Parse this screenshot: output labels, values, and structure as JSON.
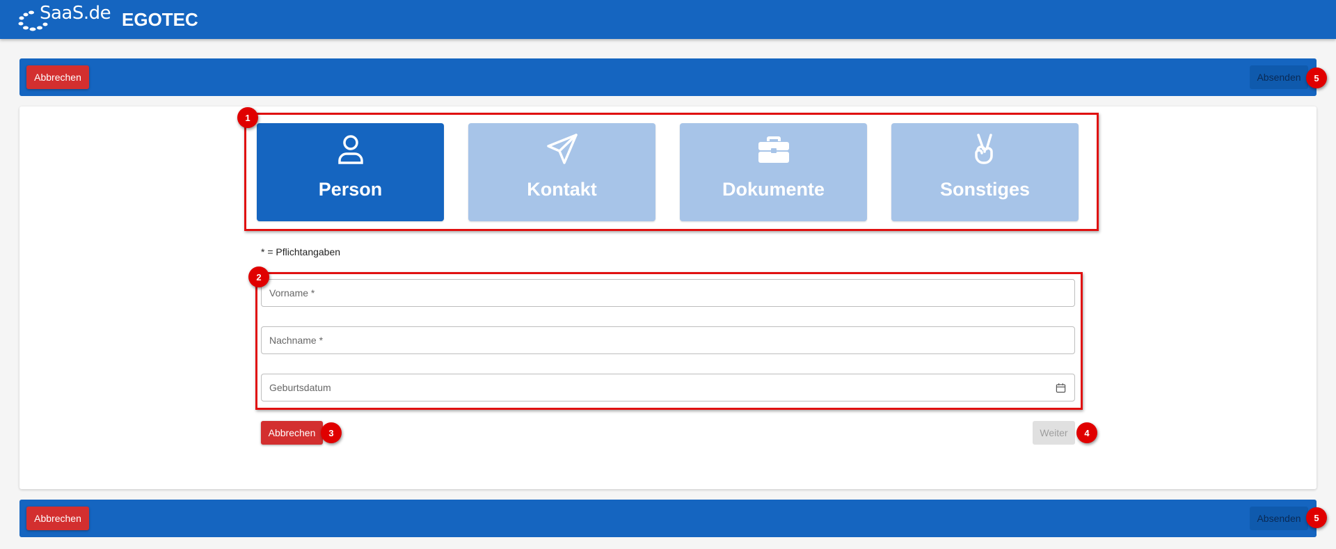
{
  "header": {
    "logo_text": "SaaS.de",
    "title": "EGOTEC"
  },
  "action_bar": {
    "cancel_label": "Abbrechen",
    "submit_label": "Absenden"
  },
  "steps": [
    {
      "label": "Person",
      "icon": "user-icon",
      "active": true
    },
    {
      "label": "Kontakt",
      "icon": "paper-plane-icon",
      "active": false
    },
    {
      "label": "Dokumente",
      "icon": "briefcase-icon",
      "active": false
    },
    {
      "label": "Sonstiges",
      "icon": "victory-hand-icon",
      "active": false
    }
  ],
  "form": {
    "required_note": "* = Pflichtangaben",
    "fields": [
      {
        "placeholder": "Vorname *",
        "value": ""
      },
      {
        "placeholder": "Nachname *",
        "value": ""
      },
      {
        "placeholder": "Geburtsdatum",
        "value": "",
        "icon": "calendar-icon"
      }
    ],
    "cancel_label": "Abbrechen",
    "next_label": "Weiter"
  },
  "annotations": {
    "badge_1": "1",
    "badge_2": "2",
    "badge_3": "3",
    "badge_4": "4",
    "badge_5": "5"
  },
  "colors": {
    "primary": "#1565c0",
    "tab_inactive": "#a7c4e8",
    "danger": "#d32f2f",
    "highlight": "#e01010"
  }
}
